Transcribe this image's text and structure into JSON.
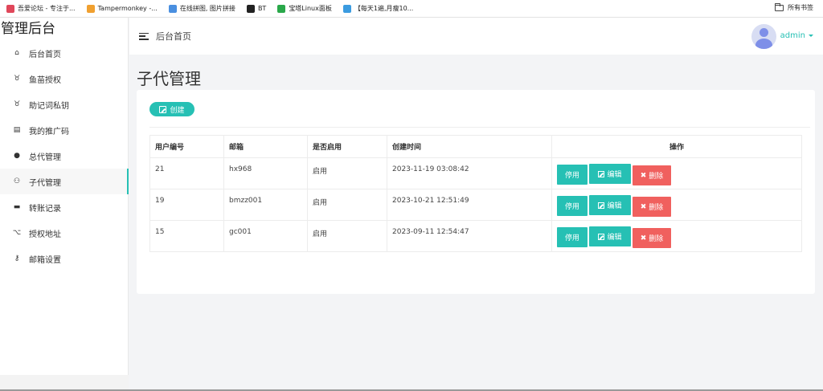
{
  "bookmarks": [
    {
      "label": "吾爱论坛 - 专注于...",
      "color": "#e0475a"
    },
    {
      "label": "Tampermonkey -...",
      "color": "#f0a030"
    },
    {
      "label": "在线拼图, 图片拼接",
      "color": "#4a8fe0"
    },
    {
      "label": "BT",
      "color": "#222222"
    },
    {
      "label": "宝塔Linux面板",
      "color": "#2aa84a"
    },
    {
      "label": "【每天1遍,月瘦10...",
      "color": "#3b9be0"
    }
  ],
  "bookmarks_all": "所有书签",
  "brand": "管理后台",
  "sidebar": {
    "items": [
      {
        "label": "后台首页",
        "icon": "home-icon",
        "glyph": "⌂"
      },
      {
        "label": "鱼苗授权",
        "icon": "fish-icon",
        "glyph": "♉"
      },
      {
        "label": "助记词私钥",
        "icon": "key-list-icon",
        "glyph": "♉"
      },
      {
        "label": "我的推广码",
        "icon": "document-icon",
        "glyph": "▤"
      },
      {
        "label": "总代管理",
        "icon": "user-icon",
        "glyph": "●"
      },
      {
        "label": "子代管理",
        "icon": "users-icon",
        "glyph": "⚇",
        "active": true
      },
      {
        "label": "转账记录",
        "icon": "record-icon",
        "glyph": "▬"
      },
      {
        "label": "授权地址",
        "icon": "address-icon",
        "glyph": "⌥"
      },
      {
        "label": "邮箱设置",
        "icon": "key-icon",
        "glyph": "⚷"
      }
    ]
  },
  "header": {
    "title": "后台首页",
    "user": "admin"
  },
  "page": {
    "title": "子代管理",
    "create_label": "创建"
  },
  "table": {
    "columns": [
      "用户编号",
      "邮箱",
      "是否启用",
      "创建时间",
      "操作"
    ],
    "rows": [
      {
        "id": "21",
        "email": "hx968",
        "enabled": "启用",
        "created": "2023-11-19 03:08:42"
      },
      {
        "id": "19",
        "email": "bmzz001",
        "enabled": "启用",
        "created": "2023-10-21 12:51:49"
      },
      {
        "id": "15",
        "email": "gc001",
        "enabled": "启用",
        "created": "2023-09-11 12:54:47"
      }
    ],
    "actions": {
      "disable": "停用",
      "edit": "编辑",
      "delete": "删除"
    }
  },
  "colors": {
    "accent": "#26c0b4",
    "danger": "#f0605e"
  }
}
